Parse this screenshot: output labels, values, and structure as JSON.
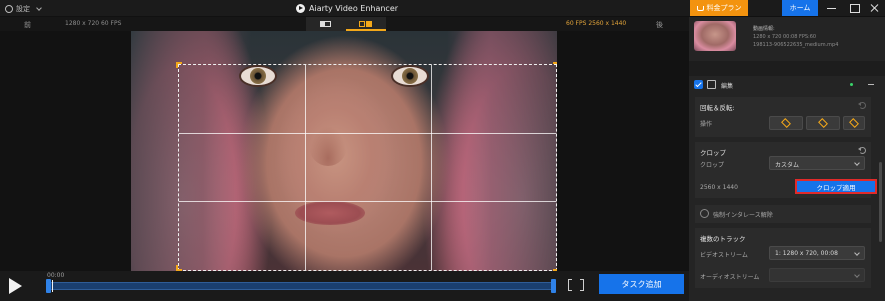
{
  "topbar": {
    "settings_label": "設定",
    "app_title": "Aiarty Video Enhancer",
    "pricing_label": "料金プラン",
    "home_label": "ホーム"
  },
  "preview": {
    "before_label": "前",
    "after_label": "後",
    "source_info": "1280 x 720  60 FPS",
    "output_info": "60 FPS  2560 x 1440"
  },
  "playback": {
    "current_time": "00:00",
    "add_task_label": "タスク追加"
  },
  "panel": {
    "file_info_title": "動画情報:",
    "file_info_line1": "1280 x 720  00:08  FPS:60",
    "file_info_line2": "198113-906522635_medium.mp4",
    "edit_title": "編集",
    "rotate_title": "回転＆反転:",
    "rotate_op_label": "操作",
    "crop_title": "クロップ",
    "crop_label": "クロップ",
    "crop_mode": "カスタム",
    "crop_resolution": "2560 x 1440",
    "apply_crop_label": "クロップ適用",
    "deinterlace_label": "強制インタレース解除",
    "tracks_title": "複数のトラック",
    "video_stream_label": "ビデオストリーム",
    "video_stream_value": "1: 1280 x 720, 00:08",
    "audio_stream_label": "オーディオストリーム",
    "audio_stream_value": ""
  },
  "colors": {
    "accent_blue": "#1673ea",
    "accent_orange": "#f3930f",
    "crop_handle": "#f3a81a",
    "highlight_red": "#e12a2a"
  }
}
